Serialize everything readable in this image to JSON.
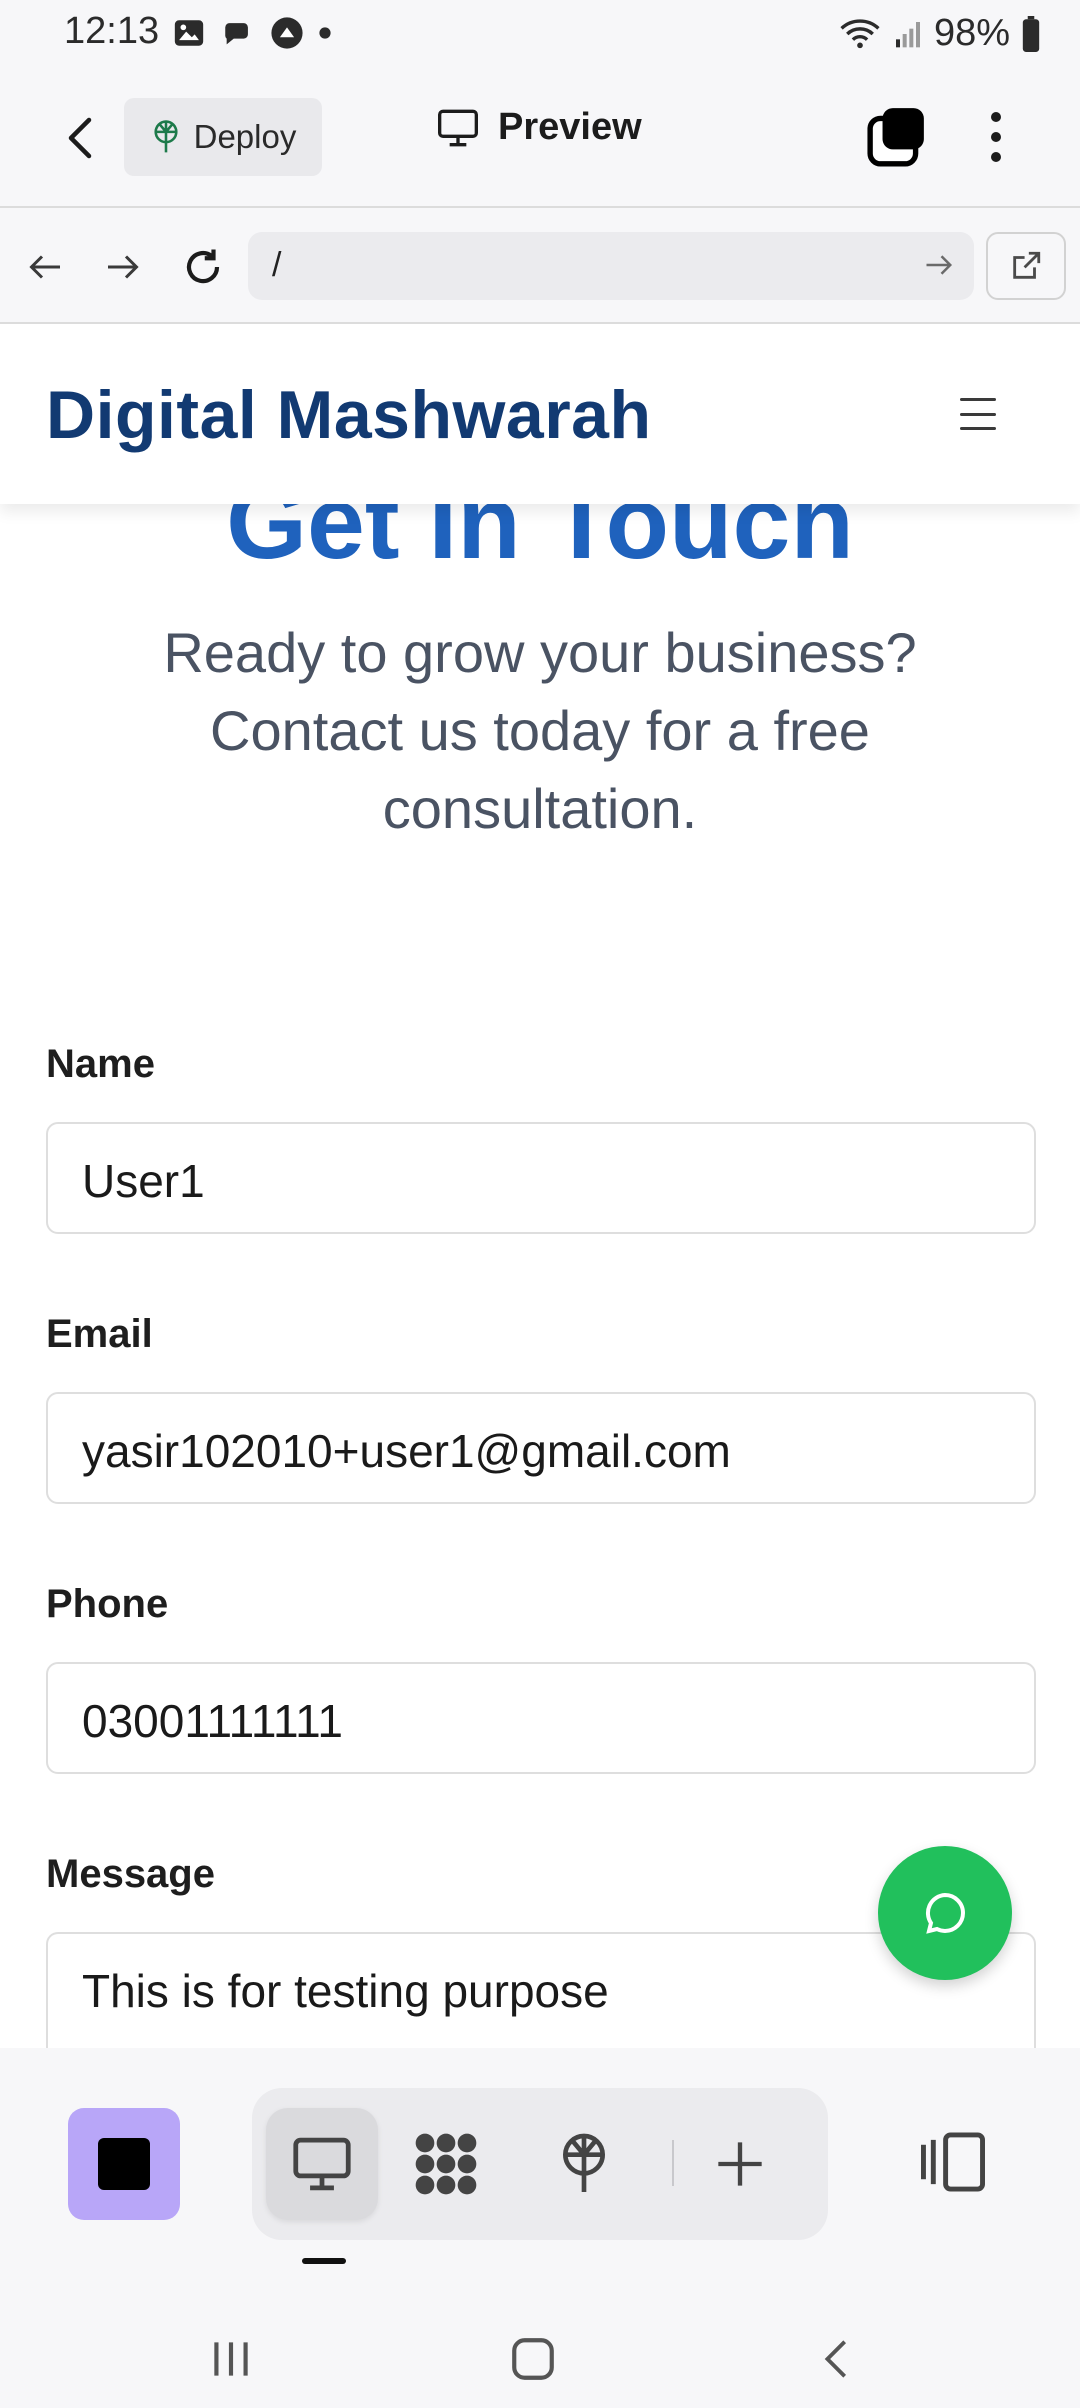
{
  "status_bar": {
    "time": "12:13",
    "battery": "98%",
    "left_icons": [
      "image-icon",
      "chat-bubble-icon",
      "upload-circle-icon",
      "dot-icon"
    ],
    "right_icons": [
      "wifi-icon",
      "signal-icon",
      "battery-icon"
    ]
  },
  "app_bar": {
    "deploy_label": "Deploy",
    "preview_label": "Preview"
  },
  "url_bar": {
    "url": "/"
  },
  "site": {
    "logo": "Digital Mashwarah",
    "section_title": "Get In Touch",
    "subtitle": "Ready to grow your business? Contact us today for a free consultation."
  },
  "form": {
    "fields": [
      {
        "label": "Name",
        "value": "User1"
      },
      {
        "label": "Email",
        "value": "yasir102010+user1@gmail.com"
      },
      {
        "label": "Phone",
        "value": "03001111111"
      },
      {
        "label": "Message",
        "value": "This is for testing purpose"
      }
    ]
  },
  "colors": {
    "logo": "#123a72",
    "title": "#1f62bd",
    "fab": "#21c05c",
    "app_square": "#b8a6f8"
  }
}
